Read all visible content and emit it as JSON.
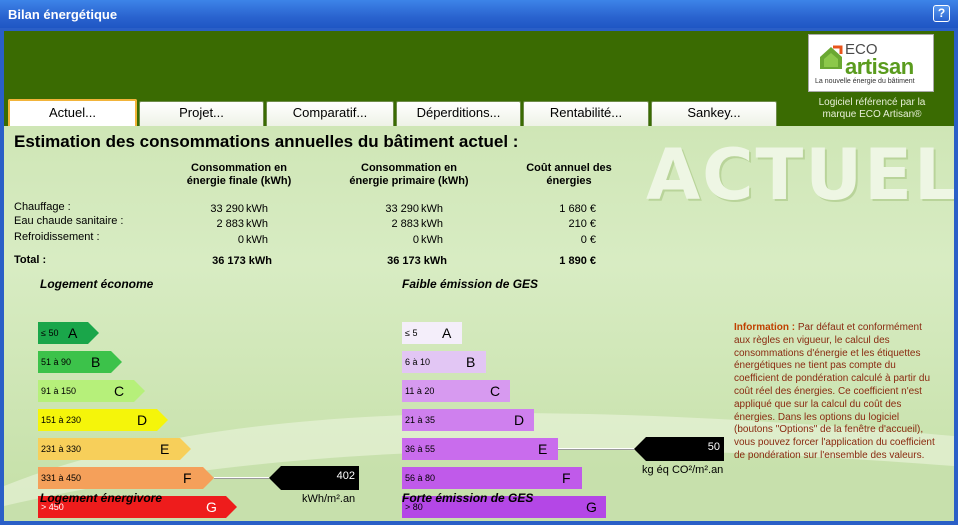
{
  "window": {
    "title": "Bilan énergétique",
    "help_label": "?"
  },
  "branding": {
    "logo_eco": "ECO",
    "logo_artisan": "artisan",
    "logo_tagline": "La nouvelle énergie du bâtiment",
    "reference_text": "Logiciel référencé par la marque ECO Artisan®"
  },
  "tabs": [
    {
      "label": "Actuel...",
      "active": true
    },
    {
      "label": "Projet...",
      "active": false
    },
    {
      "label": "Comparatif...",
      "active": false
    },
    {
      "label": "Déperditions...",
      "active": false
    },
    {
      "label": "Rentabilité...",
      "active": false
    },
    {
      "label": "Sankey...",
      "active": false
    }
  ],
  "watermark": "ACTUEL",
  "heading": "Estimation des consommations annuelles du bâtiment actuel :",
  "table": {
    "columns": [
      "Consommation en énergie finale (kWh)",
      "Consommation en énergie primaire (kWh)",
      "Coût annuel des énergies"
    ],
    "col_lines": [
      [
        "Consommation en",
        "énergie finale (kWh)"
      ],
      [
        "Consommation en",
        "énergie primaire (kWh)"
      ],
      [
        "Coût annuel des",
        "énergies"
      ]
    ],
    "rows": [
      {
        "label": "Chauffage :",
        "final": "33 290",
        "final_unit": "kWh",
        "primary": "33 290",
        "primary_unit": "kWh",
        "cost": "1 680 €"
      },
      {
        "label": "Eau chaude sanitaire :",
        "final": "2 883",
        "final_unit": "kWh",
        "primary": "2 883",
        "primary_unit": "kWh",
        "cost": "210 €"
      },
      {
        "label": "Refroidissement :",
        "final": "0",
        "final_unit": "kWh",
        "primary": "0",
        "primary_unit": "kWh",
        "cost": "0 €"
      }
    ],
    "total": {
      "label": "Total :",
      "final": "36 173 kWh",
      "primary": "36 173 kWh",
      "cost": "1 890 €"
    }
  },
  "energy_scale": {
    "top_label": "Logement économe",
    "bottom_label": "Logement énergivore",
    "bars": [
      {
        "range": "≤ 50",
        "letter": "A",
        "color": "#1aa64a"
      },
      {
        "range": "51 à 90",
        "letter": "B",
        "color": "#3cc24a"
      },
      {
        "range": "91 à 150",
        "letter": "C",
        "color": "#b6f07a"
      },
      {
        "range": "151 à 230",
        "letter": "D",
        "color": "#f5f50a"
      },
      {
        "range": "231 à 330",
        "letter": "E",
        "color": "#f7cf5a"
      },
      {
        "range": "331 à 450",
        "letter": "F",
        "color": "#f5a05a"
      },
      {
        "range": "> 450",
        "letter": "G",
        "color": "#ee1c1c"
      }
    ],
    "value": "402",
    "unit": "kWh/m².an",
    "marker_index": 5
  },
  "ges_scale": {
    "top_label": "Faible émission de GES",
    "bottom_label": "Forte émission de GES",
    "bars": [
      {
        "range": "≤ 5",
        "letter": "A",
        "color": "#f4eefa"
      },
      {
        "range": "6 à 10",
        "letter": "B",
        "color": "#e2c6f4"
      },
      {
        "range": "11 à 20",
        "letter": "C",
        "color": "#d79af0"
      },
      {
        "range": "21 à 35",
        "letter": "D",
        "color": "#cf80ee"
      },
      {
        "range": "36 à 55",
        "letter": "E",
        "color": "#c96ced"
      },
      {
        "range": "56 à 80",
        "letter": "F",
        "color": "#c05aea"
      },
      {
        "range": "> 80",
        "letter": "G",
        "color": "#b447e6"
      }
    ],
    "value": "50",
    "unit": "kg éq CO²/m².an",
    "marker_index": 4
  },
  "information": {
    "label": "Information :",
    "text": "Par défaut et conformément aux règles en vigueur, le calcul des consommations d'énergie et les étiquettes énergétiques ne tient pas compte du coefficient de pondération calculé à partir du coût réel des énergies. Ce coefficient n'est appliqué que sur la calcul du coût des énergies. Dans les options du logiciel (boutons \"Options\" de la fenêtre d'accueil), vous pouvez forcer l'application du coefficient de pondération sur l'ensemble des valeurs."
  }
}
